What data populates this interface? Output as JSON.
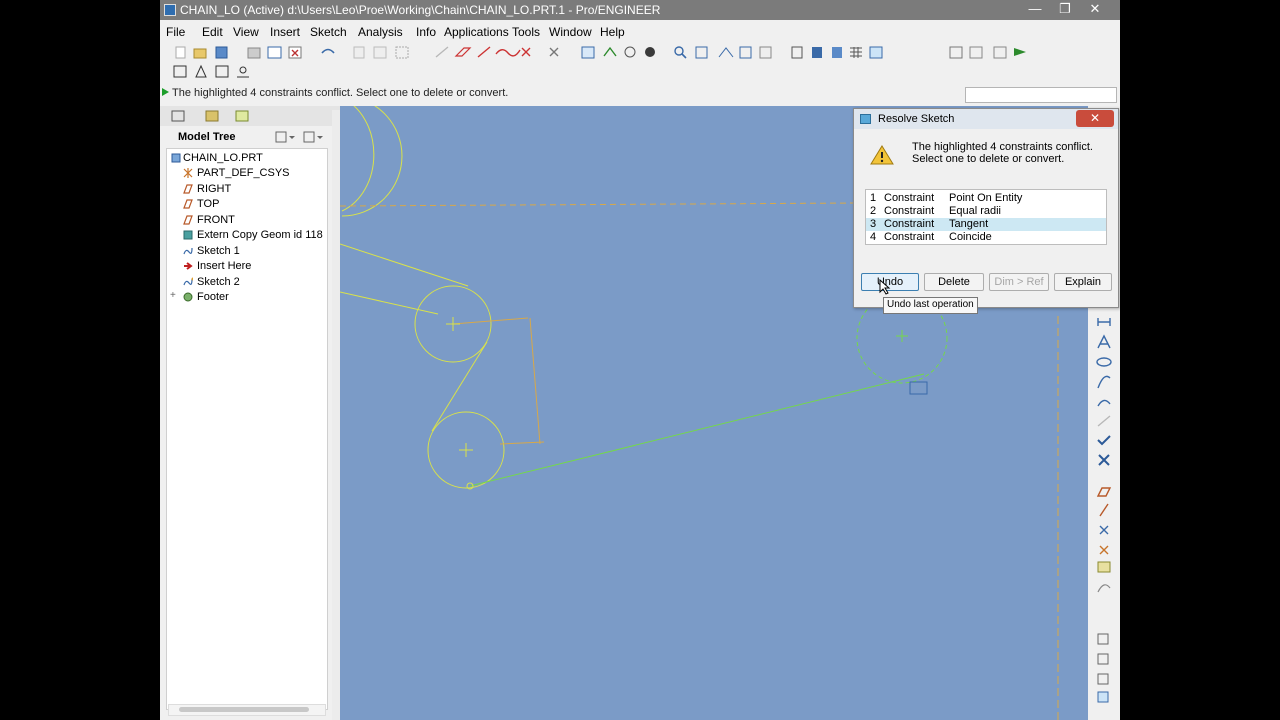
{
  "window": {
    "title": "CHAIN_LO (Active) d:\\Users\\Leo\\Proe\\Working\\Chain\\CHAIN_LO.PRT.1 - Pro/ENGINEER",
    "minimize": "—",
    "maximize": "❐",
    "close": "✕"
  },
  "menu": [
    "File",
    "Edit",
    "View",
    "Insert",
    "Sketch",
    "Analysis",
    "Info",
    "Applications",
    "Tools",
    "Window",
    "Help"
  ],
  "message": "The highlighted 4 constraints conflict. Select one to delete or convert.",
  "model_tree": {
    "title": "Model Tree",
    "items": [
      {
        "label": "CHAIN_LO.PRT",
        "icon": "part-icon"
      },
      {
        "label": "PART_DEF_CSYS",
        "icon": "csys-icon"
      },
      {
        "label": "RIGHT",
        "icon": "datum-plane-icon"
      },
      {
        "label": "TOP",
        "icon": "datum-plane-icon"
      },
      {
        "label": "FRONT",
        "icon": "datum-plane-icon"
      },
      {
        "label": "Extern Copy Geom id 118",
        "icon": "copy-geom-icon"
      },
      {
        "label": "Sketch 1",
        "icon": "sketch-icon"
      },
      {
        "label": "Insert Here",
        "icon": "insert-here-arrow-icon"
      },
      {
        "label": "Sketch 2",
        "icon": "sketch-icon"
      },
      {
        "label": "Footer",
        "icon": "footer-icon"
      }
    ]
  },
  "dialog": {
    "title": "Resolve Sketch",
    "close": "✕",
    "message_line1": "The highlighted 4 constraints conflict.",
    "message_line2": "Select one to delete or convert.",
    "rows": [
      {
        "num": "1",
        "kind": "Constraint",
        "name": "Point On Entity"
      },
      {
        "num": "2",
        "kind": "Constraint",
        "name": "Equal radii"
      },
      {
        "num": "3",
        "kind": "Constraint",
        "name": "Tangent"
      },
      {
        "num": "4",
        "kind": "Constraint",
        "name": "Coincide"
      }
    ],
    "selected_row": 3,
    "buttons": {
      "undo": "Undo",
      "delete": "Delete",
      "dimref": "Dim > Ref",
      "explain": "Explain"
    },
    "tooltip": "Undo last operation"
  },
  "colors": {
    "canvas": "#7b9bc7",
    "sketch": "#d9e24a",
    "constraint_green": "#74d84a",
    "dim_orange": "#d7a84a",
    "accent": "#3c7fb1"
  }
}
